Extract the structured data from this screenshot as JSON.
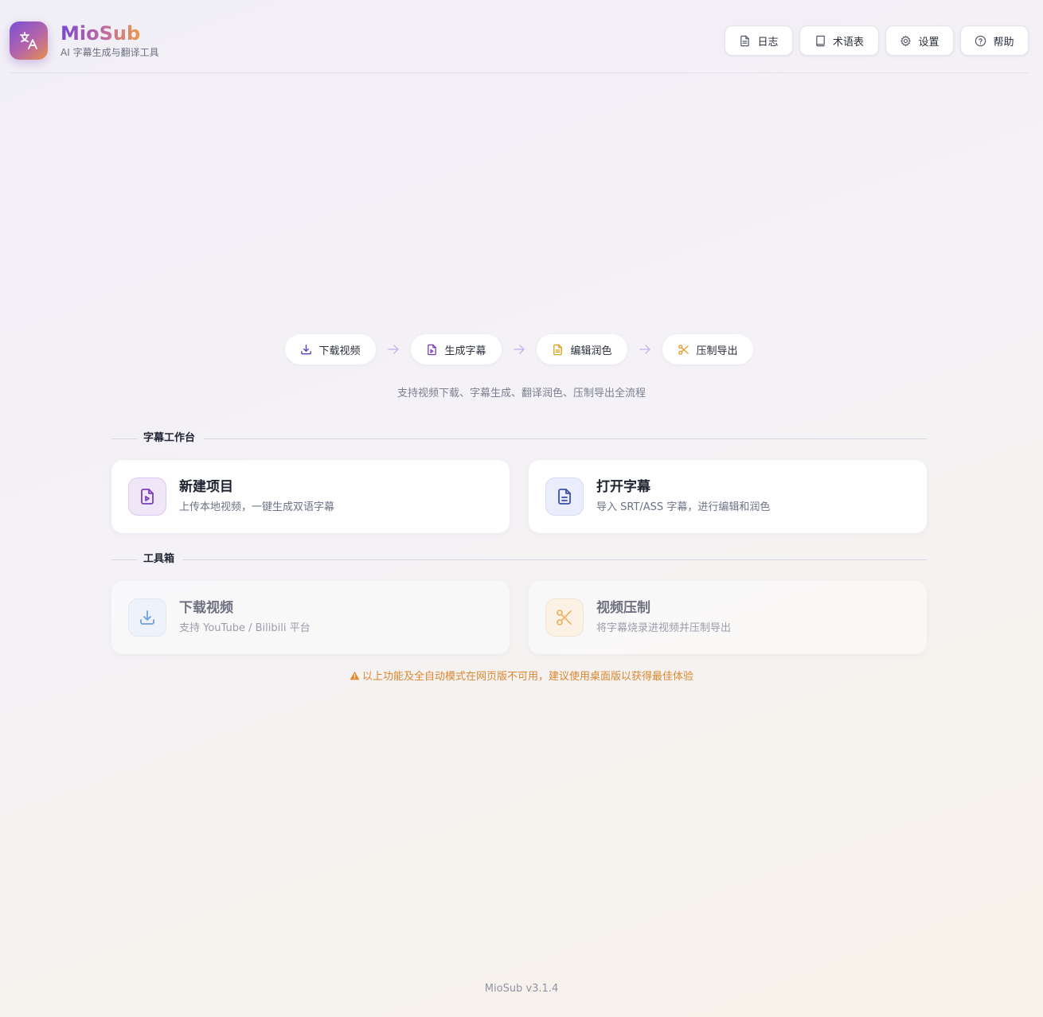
{
  "app": {
    "title": "MioSub",
    "subtitle": "AI 字幕生成与翻译工具",
    "logo_icon": "translate-icon"
  },
  "header": {
    "buttons": [
      {
        "label": "日志",
        "icon": "file-text-icon"
      },
      {
        "label": "术语表",
        "icon": "book-icon"
      },
      {
        "label": "设置",
        "icon": "gear-icon"
      },
      {
        "label": "帮助",
        "icon": "help-circle-icon"
      }
    ]
  },
  "pipeline": {
    "steps": [
      {
        "label": "下载视频",
        "icon": "download-icon",
        "color": "#5b3fc0"
      },
      {
        "label": "生成字幕",
        "icon": "video-file-icon",
        "color": "#7a3fb8"
      },
      {
        "label": "编辑润色",
        "icon": "document-icon",
        "color": "#d9a01e"
      },
      {
        "label": "压制导出",
        "icon": "scissors-icon",
        "color": "#e39a2a"
      }
    ],
    "tagline": "支持视频下载、字幕生成、翻译润色、压制导出全流程"
  },
  "workbench": {
    "title": "字幕工作台",
    "cards": [
      {
        "title": "新建项目",
        "desc": "上传本地视频，一键生成双语字幕",
        "icon": "video-file-icon"
      },
      {
        "title": "打开字幕",
        "desc": "导入 SRT/ASS 字幕，进行编辑和润色",
        "icon": "document-icon"
      }
    ]
  },
  "toolbox": {
    "title": "工具箱",
    "cards": [
      {
        "title": "下载视频",
        "desc": "支持 YouTube / Bilibili 平台",
        "icon": "download-icon"
      },
      {
        "title": "视频压制",
        "desc": "将字幕烧录进视频并压制导出",
        "icon": "scissors-icon"
      }
    ],
    "warning": "以上功能及全自动模式在网页版不可用，建议使用桌面版以获得最佳体验"
  },
  "footer": {
    "version": "MioSub v3.1.4"
  },
  "colors": {
    "accent_purple": "#7a48d0",
    "accent_orange": "#e99a48",
    "warning": "#d9862e"
  }
}
